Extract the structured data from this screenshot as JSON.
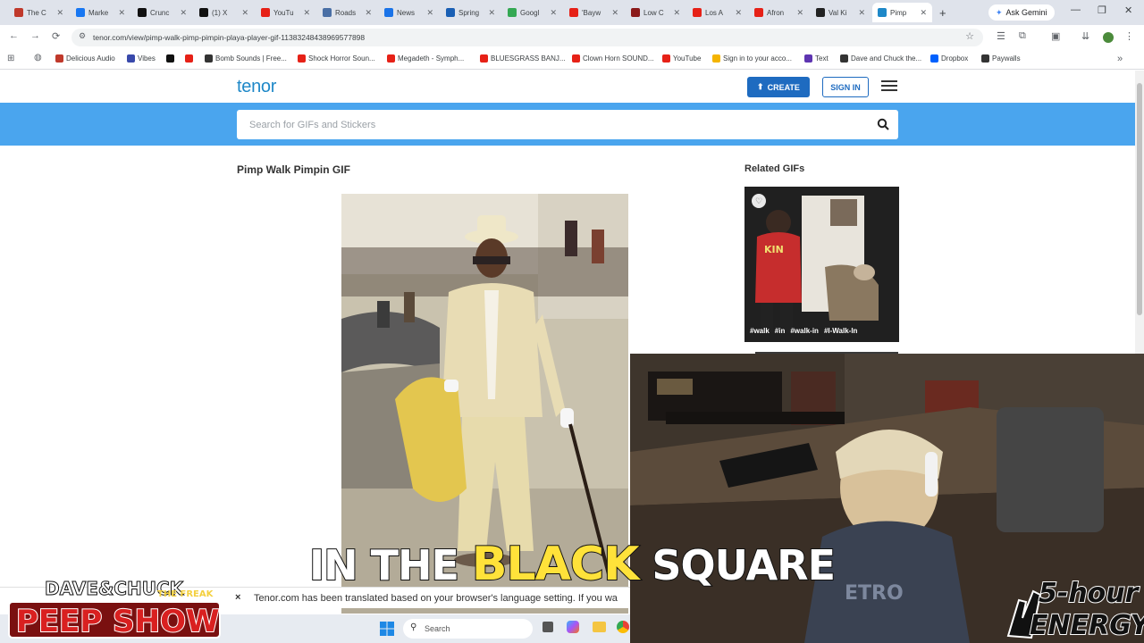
{
  "browser": {
    "tabs": [
      {
        "label": "The C",
        "color": "#c0392b"
      },
      {
        "label": "Marke",
        "color": "#1877f2"
      },
      {
        "label": "Crunc",
        "color": "#111111"
      },
      {
        "label": "(1) X",
        "color": "#111111"
      },
      {
        "label": "YouTu",
        "color": "#e62117"
      },
      {
        "label": "Roads",
        "color": "#4a6fa5"
      },
      {
        "label": "News",
        "color": "#1a73e8"
      },
      {
        "label": "Spring",
        "color": "#1a5fb4"
      },
      {
        "label": "Googl",
        "color": "#34a853"
      },
      {
        "label": "'Bayw",
        "color": "#e62117"
      },
      {
        "label": "Low C",
        "color": "#8b1a1a"
      },
      {
        "label": "Los A",
        "color": "#e62117"
      },
      {
        "label": "Afron",
        "color": "#e62117"
      },
      {
        "label": "Val Ki",
        "color": "#222222"
      },
      {
        "label": "Pimp",
        "color": "#1e88c8"
      }
    ],
    "new_tab": "+",
    "ask_gemini": "Ask Gemini",
    "url": "tenor.com/view/pimp-walk-pimp-pimpin-playa-player-gif-11383248438969577898",
    "bookmarks": [
      {
        "label": "Delicious Audio",
        "color": "#c0392b"
      },
      {
        "label": "Vibes",
        "color": "#3949ab"
      },
      {
        "label": "",
        "color": "#111111"
      },
      {
        "label": "",
        "color": "#e62117"
      },
      {
        "label": "Bomb Sounds | Free...",
        "color": "#333333"
      },
      {
        "label": "Shock Horror Soun...",
        "color": "#e62117"
      },
      {
        "label": "Megadeth - Symph...",
        "color": "#e62117"
      },
      {
        "label": "BLUESGRASS BANJ...",
        "color": "#e62117"
      },
      {
        "label": "Clown Horn SOUND...",
        "color": "#e62117"
      },
      {
        "label": "YouTube",
        "color": "#e62117"
      },
      {
        "label": "Sign in to your acco...",
        "color": "#f4b400"
      },
      {
        "label": "Text",
        "color": "#5e35b1"
      },
      {
        "label": "Dave and Chuck the...",
        "color": "#333333"
      },
      {
        "label": "Dropbox",
        "color": "#0061fe"
      },
      {
        "label": "Paywalls",
        "color": "#333333"
      }
    ]
  },
  "tenor": {
    "logo": "tenor",
    "create_label": "CREATE",
    "signin_label": "SIGN IN",
    "search_placeholder": "Search for GIFs and Stickers",
    "gif_title": "Pimp Walk Pimpin GIF",
    "related_title": "Related GIFs",
    "related_tags": [
      "#walk",
      "#in",
      "#walk-in",
      "#I-Walk-In"
    ],
    "translate_notice": "Tenor.com has been translated based on your browser's language setting. If you wa",
    "translate_close": "×",
    "accent": "#4aa5ee"
  },
  "taskbar": {
    "search_label": "Search"
  },
  "overlay": {
    "caption_words": [
      "IN THE",
      "BLACK",
      "SQUARE"
    ],
    "show_logo_top": "DAVE&CHUCK",
    "show_logo_tag": "THE FREAK",
    "show_logo_bottom": "PEEP SHOW",
    "energy_logo": "5-hour ENERGY"
  }
}
